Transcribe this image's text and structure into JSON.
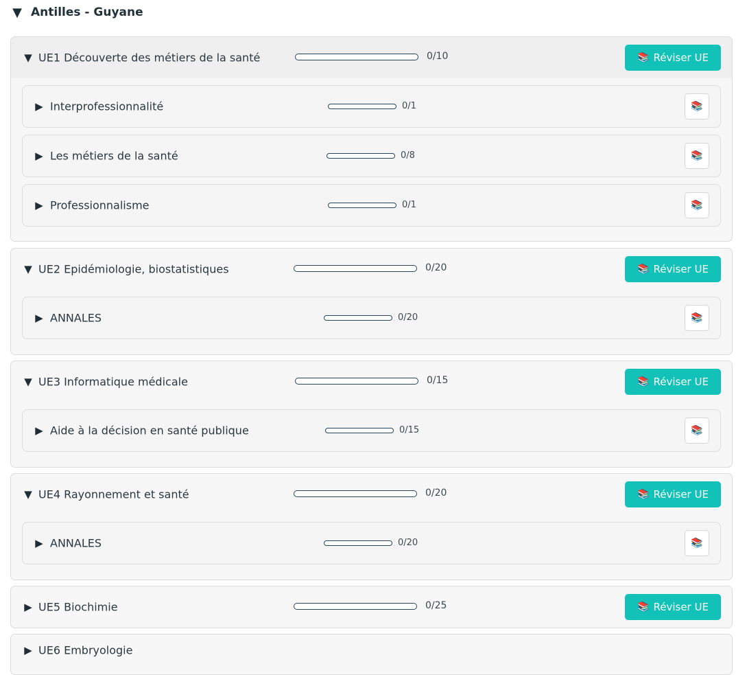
{
  "region": {
    "caret": "▼",
    "title": "Antilles - Guyane"
  },
  "ue_button_label": "Réviser UE",
  "books_icon": "📚",
  "ue": [
    {
      "caret": "▼",
      "title": "UE1 Découverte des métiers de la santé",
      "count": "0/10",
      "progress": 0,
      "expanded": true,
      "subs": [
        {
          "caret": "▶",
          "title": "Interprofessionnalité",
          "count": "0/1",
          "progress": 0
        },
        {
          "caret": "▶",
          "title": "Les métiers de la santé",
          "count": "0/8",
          "progress": 0
        },
        {
          "caret": "▶",
          "title": "Professionnalisme",
          "count": "0/1",
          "progress": 0
        }
      ]
    },
    {
      "caret": "▼",
      "title": "UE2 Epidémiologie, biostatistiques",
      "count": "0/20",
      "progress": 0,
      "expanded": true,
      "subs": [
        {
          "caret": "▶",
          "title": "ANNALES",
          "count": "0/20",
          "progress": 0
        }
      ]
    },
    {
      "caret": "▼",
      "title": "UE3 Informatique médicale",
      "count": "0/15",
      "progress": 0,
      "expanded": true,
      "subs": [
        {
          "caret": "▶",
          "title": "Aide à la décision en santé publique",
          "count": "0/15",
          "progress": 0
        }
      ]
    },
    {
      "caret": "▼",
      "title": "UE4 Rayonnement et santé",
      "count": "0/20",
      "progress": 0,
      "expanded": true,
      "subs": [
        {
          "caret": "▶",
          "title": "ANNALES",
          "count": "0/20",
          "progress": 0
        }
      ]
    },
    {
      "caret": "▶",
      "title": "UE5 Biochimie",
      "count": "0/25",
      "progress": 0,
      "expanded": false,
      "subs": []
    },
    {
      "caret": "▶",
      "title": "UE6 Embryologie",
      "expanded": false,
      "subs": []
    }
  ],
  "colors": {
    "accent": "#12c1b7",
    "bar_border": "#27465e"
  }
}
